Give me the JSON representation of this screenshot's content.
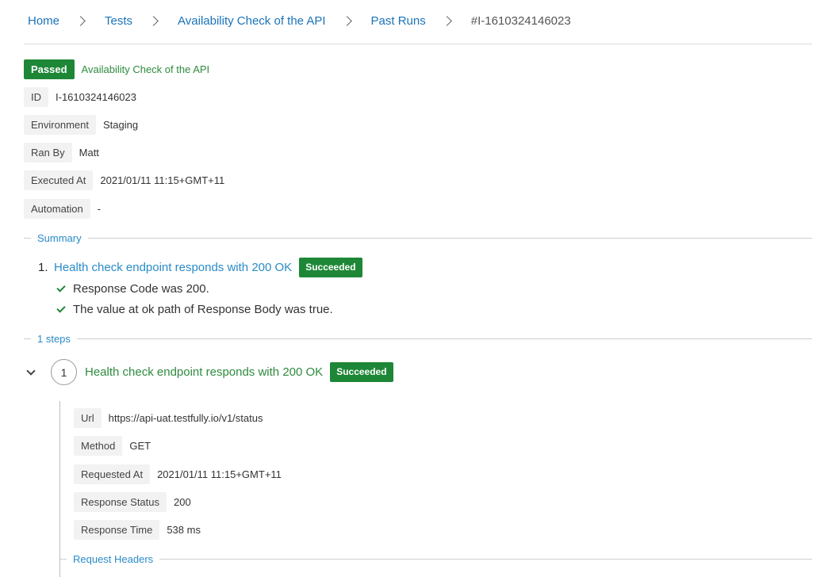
{
  "breadcrumb": {
    "home": "Home",
    "tests": "Tests",
    "test_name": "Availability Check of the API",
    "past_runs": "Past Runs",
    "current": "#I-1610324146023"
  },
  "run": {
    "status": "Passed",
    "test_name": "Availability Check of the API",
    "meta": [
      {
        "label": "ID",
        "value": "I-1610324146023"
      },
      {
        "label": "Environment",
        "value": "Staging"
      },
      {
        "label": "Ran By",
        "value": "Matt"
      },
      {
        "label": "Executed At",
        "value": "2021/01/11 11:15+GMT+11"
      },
      {
        "label": "Automation",
        "value": "-"
      }
    ]
  },
  "summary": {
    "title": "Summary",
    "items": [
      {
        "number": "1.",
        "name": "Health check endpoint responds with 200 OK",
        "status": "Succeeded",
        "checks": [
          "Response Code was 200.",
          "The value at ok path of Response Body was true."
        ]
      }
    ]
  },
  "steps": {
    "title": "1 steps",
    "items": [
      {
        "index": "1",
        "name": "Health check endpoint responds with 200 OK",
        "status": "Succeeded",
        "details": [
          {
            "label": "Url",
            "value": "https://api-uat.testfully.io/v1/status"
          },
          {
            "label": "Method",
            "value": "GET"
          },
          {
            "label": "Requested At",
            "value": "2021/01/11 11:15+GMT+11"
          },
          {
            "label": "Response Status",
            "value": "200"
          },
          {
            "label": "Response Time",
            "value": "538 ms"
          }
        ],
        "request_headers_title": "Request Headers"
      }
    ]
  },
  "colors": {
    "link": "#1a73b8",
    "success": "#1e8737",
    "success_text": "#2e8b3e",
    "section_title": "#2a8bc6",
    "tag_bg": "#f2f2f2"
  },
  "icons": {
    "breadcrumb_separator": "chevron-right-icon",
    "check": "check-icon",
    "collapse": "chevron-down-icon"
  }
}
